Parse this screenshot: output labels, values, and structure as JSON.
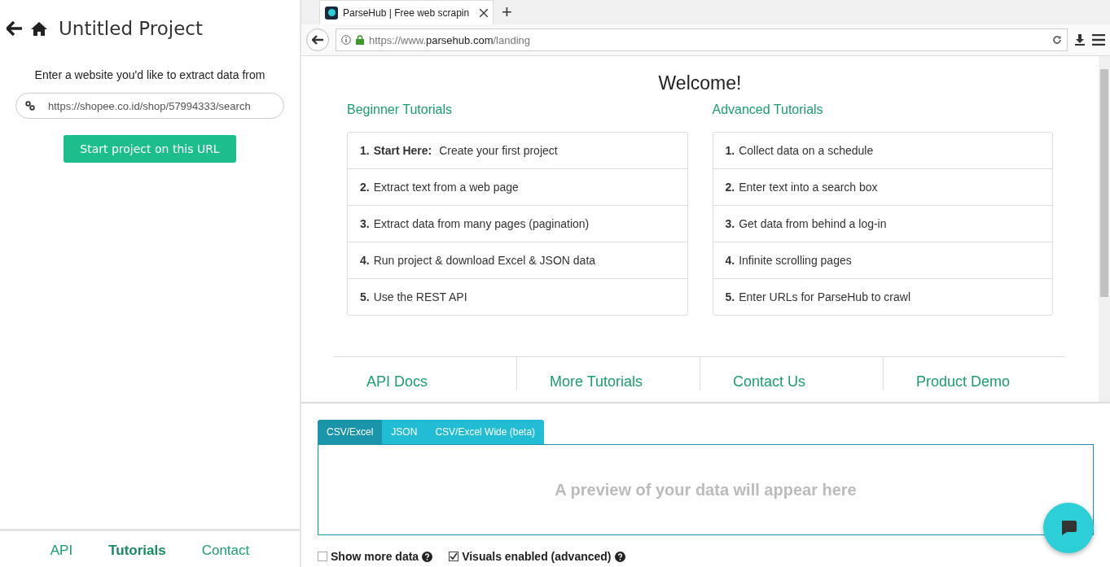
{
  "project": {
    "title": "Untitled Project",
    "prompt": "Enter a website you'd like to extract data from",
    "url_value": "https://shopee.co.id/shop/57994333/search",
    "start_button": "Start project on this URL"
  },
  "footer_tabs": [
    {
      "label": "API",
      "selected": false
    },
    {
      "label": "Tutorials",
      "selected": true
    },
    {
      "label": "Contact",
      "selected": false
    }
  ],
  "browser": {
    "tab_title": "ParseHub | Free web scrapin",
    "new_tab": "+",
    "url": {
      "prefix": "https://www.",
      "domain": "parsehub.com",
      "path": "/landing"
    }
  },
  "page": {
    "heading": "Welcome!",
    "columns": [
      {
        "title": "Beginner Tutorials",
        "items": [
          {
            "number": "1.",
            "text": "**Start Here:** Create your first project"
          },
          {
            "number": "2.",
            "text": "Extract text from a web page"
          },
          {
            "number": "3.",
            "text": "Extract data from many pages (pagination)"
          },
          {
            "number": "4.",
            "text": "Run project & download Excel & JSON data"
          },
          {
            "number": "5.",
            "text": "Use the REST API"
          }
        ]
      },
      {
        "title": "Advanced Tutorials",
        "items": [
          {
            "number": "1.",
            "text": "Collect data on a schedule"
          },
          {
            "number": "2.",
            "text": "Enter text into a search box"
          },
          {
            "number": "3.",
            "text": "Get data from behind a log-in"
          },
          {
            "number": "4.",
            "text": "Infinite scrolling pages"
          },
          {
            "number": "5.",
            "text": "Enter URLs for ParseHub to crawl"
          }
        ]
      }
    ],
    "links": [
      "API Docs",
      "More Tutorials",
      "Contact Us",
      "Product Demo"
    ]
  },
  "data_tabs": [
    {
      "label": "CSV/Excel",
      "selected": true
    },
    {
      "label": "JSON",
      "selected": false
    },
    {
      "label": "CSV/Excel Wide (beta)",
      "selected": false
    }
  ],
  "preview_text": "A preview of your data will appear here",
  "options": [
    {
      "label": "Show more data",
      "checked": false
    },
    {
      "label": "Visuals enabled (advanced)",
      "checked": true
    }
  ]
}
